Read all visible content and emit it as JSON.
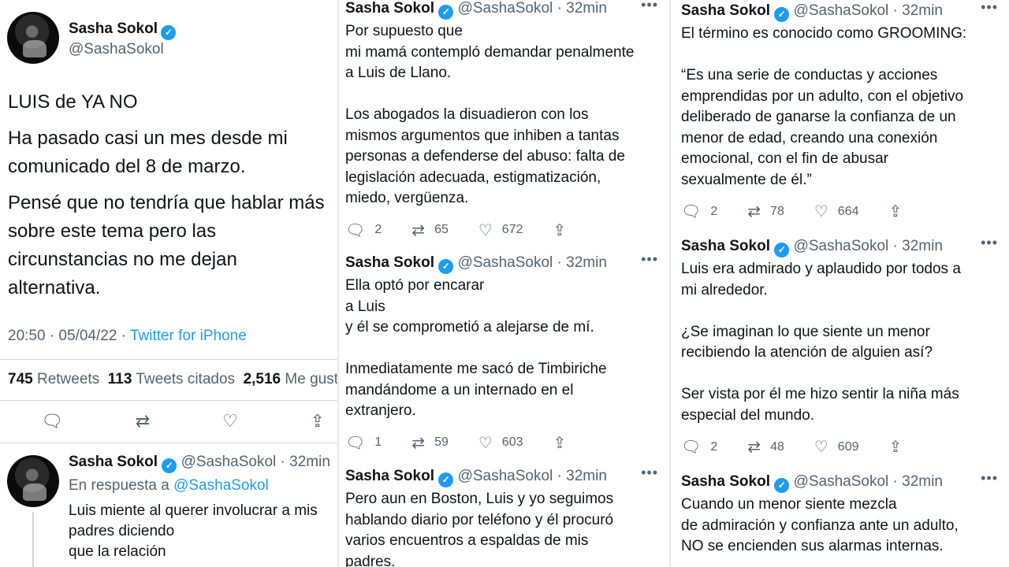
{
  "main_tweet": {
    "name": "Sasha Sokol",
    "handle": "@SashaSokol",
    "paragraphs": [
      "LUIS de YA NO",
      "Ha pasado casi un mes desde mi\ncomunicado del 8 de marzo.",
      "Pensé que no tendría que hablar más\nsobre este tema pero las\ncircunstancias no me dejan\nalternativa."
    ],
    "time": "20:50 · 05/04/22 · ",
    "source": "Twitter for iPhone",
    "retweets_count": "745",
    "retweets_label": "Retweets",
    "quotes_count": "113",
    "quotes_label": "Tweets citados",
    "likes_count": "2,516",
    "likes_label": "Me gusta"
  },
  "reply_tweet": {
    "name": "Sasha Sokol",
    "handle": "@SashaSokol",
    "time": "· 32min",
    "reply_prefix": "En respuesta a ",
    "reply_to": "@SashaSokol",
    "text": "Luis miente al querer involucrar a mis\npadres diciendo\nque la relación"
  },
  "col2": [
    {
      "name": "Sasha Sokol",
      "handle": "@SashaSokol",
      "time": "· 32min",
      "text": "Por supuesto que\nmi mamá contempló demandar penalmente\na Luis de Llano.\n\nLos abogados la disuadieron con los\nmismos argumentos que inhiben a tantas\npersonas a defenderse del abuso: falta de\nlegislación adecuada, estigmatización,\nmiedo, vergüenza.",
      "replies": "2",
      "retweets": "65",
      "likes": "672"
    },
    {
      "name": "Sasha Sokol",
      "handle": "@SashaSokol",
      "time": "· 32min",
      "text": "Ella optó por encarar\na Luis\ny él se comprometió a alejarse de mí.\n\nInmediatamente me sacó de Timbiriche\nmandándome a un internado en el\nextranjero.",
      "replies": "1",
      "retweets": "59",
      "likes": "603"
    },
    {
      "name": "Sasha Sokol",
      "handle": "@SashaSokol",
      "time": "· 32min",
      "text": "Pero aun en Boston, Luis y yo seguimos\nhablando diario por teléfono y él procuró\nvarios encuentros a espaldas de mis\npadres."
    }
  ],
  "col3": [
    {
      "name": "Sasha Sokol",
      "handle": "@SashaSokol",
      "time": "· 32min",
      "text": "El término es conocido como GROOMING:\n\n“Es una serie de conductas y acciones\nemprendidas por un adulto, con el objetivo\ndeliberado de ganarse la confianza de un\nmenor de edad, creando una conexión\nemocional, con el fin de abusar\nsexualmente de él.”",
      "replies": "2",
      "retweets": "78",
      "likes": "664"
    },
    {
      "name": "Sasha Sokol",
      "handle": "@SashaSokol",
      "time": "· 32min",
      "text": "Luis era admirado y aplaudido por todos a\nmi alrededor.\n\n¿Se imaginan lo que siente un menor\nrecibiendo la atención de alguien así?\n\nSer vista por él me hizo sentir la niña más\nespecial del mundo.",
      "replies": "2",
      "retweets": "48",
      "likes": "609"
    },
    {
      "name": "Sasha Sokol",
      "handle": "@SashaSokol",
      "time": "· 32min",
      "text": "Cuando un menor siente mezcla\nde admiración y confianza ante un adulto,\nNO se encienden sus alarmas internas."
    }
  ],
  "icons": {
    "reply": "reply-icon",
    "retweet": "retweet-icon",
    "like": "heart-icon",
    "share": "share-icon",
    "verified": "verified-badge-icon",
    "more": "more-icon"
  },
  "colors": {
    "accent": "#1d9bf0",
    "muted": "#536471",
    "text": "#0f1419",
    "divider": "#cfd9de"
  }
}
